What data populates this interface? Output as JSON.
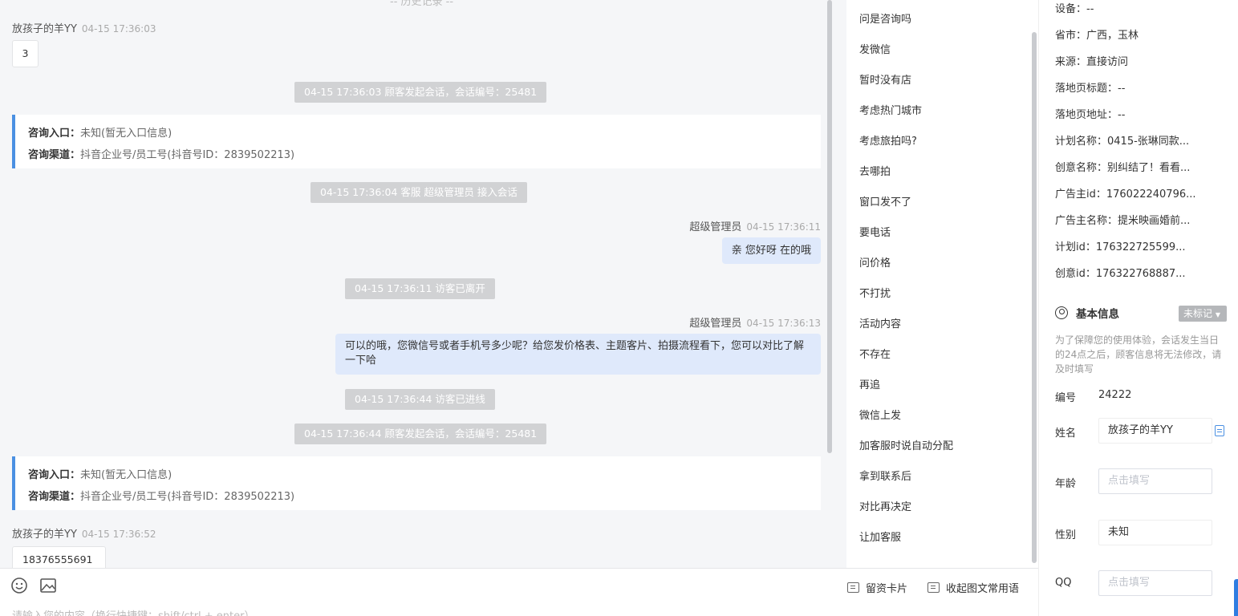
{
  "chat": {
    "top_cut": "-- 历史记录 --",
    "messages": [
      {
        "sender": "放孩子的羊YY",
        "time": "04-15 17:36:03",
        "text": "3"
      },
      {
        "system": "04-15 17:36:03 顾客发起会话，会话编号：25481"
      },
      {
        "system": "04-15 17:36:04 客服 超级管理员 接入会话"
      },
      {
        "sender": "超级管理员",
        "time": "04-15 17:36:11",
        "text": "亲 您好呀 在的哦"
      },
      {
        "system": "04-15 17:36:11 访客已离开"
      },
      {
        "sender": "超级管理员",
        "time": "04-15 17:36:13",
        "text": "可以的哦，您微信号或者手机号多少呢？给您发价格表、主题客片、拍摄流程看下，您可以对比了解一下哈"
      },
      {
        "system": "04-15 17:36:44 访客已进线"
      },
      {
        "system": "04-15 17:36:44 顾客发起会话，会话编号：25481"
      },
      {
        "sender": "放孩子的羊YY",
        "time": "04-15 17:36:52",
        "text": "18376555691"
      }
    ],
    "info_card": {
      "entry_label": "咨询入口：",
      "entry_value": "未知(暂无入口信息)",
      "channel_label": "咨询渠道：",
      "channel_value": "抖音企业号/员工号(抖音号ID：2839502213)"
    }
  },
  "input": {
    "placeholder": "请输入您的内容（换行快捷键：shift/ctrl + enter）",
    "lead_card": "留资卡片",
    "collapse_phrases": "收起图文常用语"
  },
  "quick_replies": [
    "问是咨询吗",
    "发微信",
    "暂时没有店",
    "考虑热门城市",
    "考虑旅拍吗?",
    "去哪拍",
    "窗口发不了",
    "要电话",
    "问价格",
    "不打扰",
    "活动内容",
    "不存在",
    "再追",
    "微信上发",
    "加客服时说自动分配",
    "拿到联系后",
    "对比再决定",
    "让加客服"
  ],
  "panel": {
    "details": [
      "设备：--",
      "省市：广西，玉林",
      "来源：直接访问",
      "落地页标题：--",
      "落地页地址：--",
      "计划名称：0415-张琳同款...",
      "创意名称：别纠结了！看看...",
      "广告主id：176022240796...",
      "广告主名称：提米映画婚前...",
      "计划id：176322725599...",
      "创意id：176322768887..."
    ],
    "basic_title": "基本信息",
    "tag_label": "未标记",
    "note": "为了保障您的使用体验，会话发生当日的24点之后，顾客信息将无法修改，请及时填写",
    "fields": {
      "id_label": "编号",
      "id_value": "24222",
      "name_label": "姓名",
      "name_value": "放孩子的羊YY",
      "age_label": "年龄",
      "age_placeholder": "点击填写",
      "gender_label": "性别",
      "gender_value": "未知",
      "qq_label": "QQ",
      "qq_placeholder": "点击填写"
    }
  }
}
